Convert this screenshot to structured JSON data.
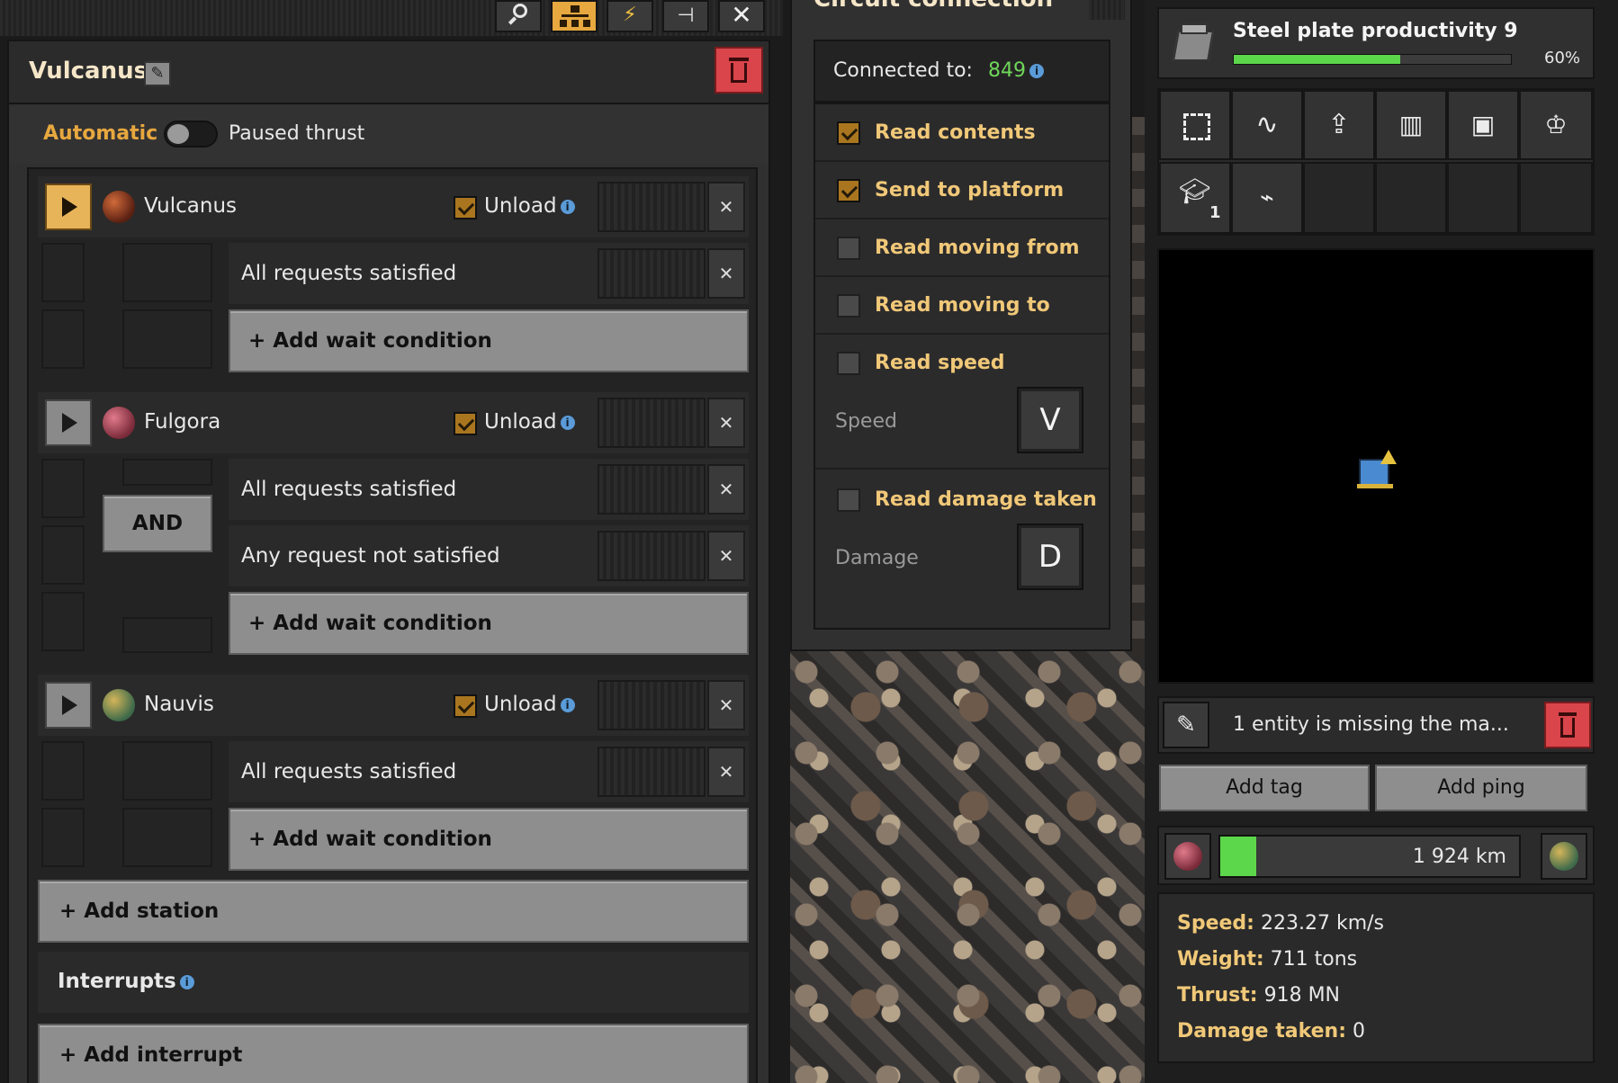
{
  "toolbar": {
    "icons": [
      "search-icon",
      "hierarchy-icon",
      "lightning-icon",
      "pin-icon",
      "close-icon"
    ]
  },
  "schedule": {
    "title": "Vulcanus",
    "automatic_label": "Automatic",
    "paused_label": "Paused thrust",
    "stations": [
      {
        "name": "Vulcanus",
        "unload_label": "Unload",
        "active": true,
        "conditions": [
          "All requests satisfied"
        ],
        "add_wait": "+ Add wait condition"
      },
      {
        "name": "Fulgora",
        "unload_label": "Unload",
        "active": false,
        "and_label": "AND",
        "conditions": [
          "All requests satisfied",
          "Any request not satisfied"
        ],
        "add_wait": "+ Add wait condition"
      },
      {
        "name": "Nauvis",
        "unload_label": "Unload",
        "active": false,
        "conditions": [
          "All requests satisfied"
        ],
        "add_wait": "+ Add wait condition"
      }
    ],
    "add_station": "+ Add station",
    "interrupts_label": "Interrupts",
    "add_interrupt": "+ Add interrupt"
  },
  "circuit": {
    "title": "Circuit connection",
    "connected_label": "Connected to:",
    "connected_value": "849",
    "options": [
      {
        "label": "Read contents",
        "checked": true
      },
      {
        "label": "Send to platform",
        "checked": true
      },
      {
        "label": "Read moving from",
        "checked": false
      },
      {
        "label": "Read moving to",
        "checked": false
      },
      {
        "label": "Read speed",
        "checked": false
      },
      {
        "label": "Read damage taken",
        "checked": false
      }
    ],
    "speed_label": "Speed",
    "speed_signal": "V",
    "damage_label": "Damage",
    "damage_signal": "D"
  },
  "research": {
    "title": "Steel plate productivity 9",
    "progress_text": "60%",
    "progress": 0.6,
    "badge_count": "1"
  },
  "platform": {
    "alert_text": "1 entity is missing the ma...",
    "add_tag": "Add tag",
    "add_ping": "Add ping",
    "distance": "1 924 km",
    "travel_progress": 0.12,
    "stats": [
      {
        "label": "Speed:",
        "value": "223.27 km/s"
      },
      {
        "label": "Weight:",
        "value": "711 tons"
      },
      {
        "label": "Thrust:",
        "value": "918 MN"
      },
      {
        "label": "Damage taken:",
        "value": "0"
      }
    ]
  },
  "colors": {
    "accent": "#e7a83f",
    "danger": "#d9454a",
    "green": "#5cd64a",
    "connected": "#6fd65a"
  }
}
